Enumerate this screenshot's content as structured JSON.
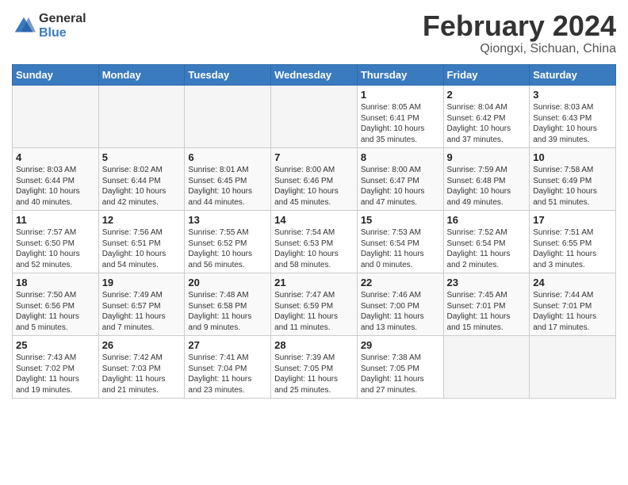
{
  "header": {
    "logo_general": "General",
    "logo_blue": "Blue",
    "title": "February 2024",
    "location": "Qiongxi, Sichuan, China"
  },
  "weekdays": [
    "Sunday",
    "Monday",
    "Tuesday",
    "Wednesday",
    "Thursday",
    "Friday",
    "Saturday"
  ],
  "weeks": [
    [
      {
        "day": "",
        "info": ""
      },
      {
        "day": "",
        "info": ""
      },
      {
        "day": "",
        "info": ""
      },
      {
        "day": "",
        "info": ""
      },
      {
        "day": "1",
        "info": "Sunrise: 8:05 AM\nSunset: 6:41 PM\nDaylight: 10 hours\nand 35 minutes."
      },
      {
        "day": "2",
        "info": "Sunrise: 8:04 AM\nSunset: 6:42 PM\nDaylight: 10 hours\nand 37 minutes."
      },
      {
        "day": "3",
        "info": "Sunrise: 8:03 AM\nSunset: 6:43 PM\nDaylight: 10 hours\nand 39 minutes."
      }
    ],
    [
      {
        "day": "4",
        "info": "Sunrise: 8:03 AM\nSunset: 6:44 PM\nDaylight: 10 hours\nand 40 minutes."
      },
      {
        "day": "5",
        "info": "Sunrise: 8:02 AM\nSunset: 6:44 PM\nDaylight: 10 hours\nand 42 minutes."
      },
      {
        "day": "6",
        "info": "Sunrise: 8:01 AM\nSunset: 6:45 PM\nDaylight: 10 hours\nand 44 minutes."
      },
      {
        "day": "7",
        "info": "Sunrise: 8:00 AM\nSunset: 6:46 PM\nDaylight: 10 hours\nand 45 minutes."
      },
      {
        "day": "8",
        "info": "Sunrise: 8:00 AM\nSunset: 6:47 PM\nDaylight: 10 hours\nand 47 minutes."
      },
      {
        "day": "9",
        "info": "Sunrise: 7:59 AM\nSunset: 6:48 PM\nDaylight: 10 hours\nand 49 minutes."
      },
      {
        "day": "10",
        "info": "Sunrise: 7:58 AM\nSunset: 6:49 PM\nDaylight: 10 hours\nand 51 minutes."
      }
    ],
    [
      {
        "day": "11",
        "info": "Sunrise: 7:57 AM\nSunset: 6:50 PM\nDaylight: 10 hours\nand 52 minutes."
      },
      {
        "day": "12",
        "info": "Sunrise: 7:56 AM\nSunset: 6:51 PM\nDaylight: 10 hours\nand 54 minutes."
      },
      {
        "day": "13",
        "info": "Sunrise: 7:55 AM\nSunset: 6:52 PM\nDaylight: 10 hours\nand 56 minutes."
      },
      {
        "day": "14",
        "info": "Sunrise: 7:54 AM\nSunset: 6:53 PM\nDaylight: 10 hours\nand 58 minutes."
      },
      {
        "day": "15",
        "info": "Sunrise: 7:53 AM\nSunset: 6:54 PM\nDaylight: 11 hours\nand 0 minutes."
      },
      {
        "day": "16",
        "info": "Sunrise: 7:52 AM\nSunset: 6:54 PM\nDaylight: 11 hours\nand 2 minutes."
      },
      {
        "day": "17",
        "info": "Sunrise: 7:51 AM\nSunset: 6:55 PM\nDaylight: 11 hours\nand 3 minutes."
      }
    ],
    [
      {
        "day": "18",
        "info": "Sunrise: 7:50 AM\nSunset: 6:56 PM\nDaylight: 11 hours\nand 5 minutes."
      },
      {
        "day": "19",
        "info": "Sunrise: 7:49 AM\nSunset: 6:57 PM\nDaylight: 11 hours\nand 7 minutes."
      },
      {
        "day": "20",
        "info": "Sunrise: 7:48 AM\nSunset: 6:58 PM\nDaylight: 11 hours\nand 9 minutes."
      },
      {
        "day": "21",
        "info": "Sunrise: 7:47 AM\nSunset: 6:59 PM\nDaylight: 11 hours\nand 11 minutes."
      },
      {
        "day": "22",
        "info": "Sunrise: 7:46 AM\nSunset: 7:00 PM\nDaylight: 11 hours\nand 13 minutes."
      },
      {
        "day": "23",
        "info": "Sunrise: 7:45 AM\nSunset: 7:01 PM\nDaylight: 11 hours\nand 15 minutes."
      },
      {
        "day": "24",
        "info": "Sunrise: 7:44 AM\nSunset: 7:01 PM\nDaylight: 11 hours\nand 17 minutes."
      }
    ],
    [
      {
        "day": "25",
        "info": "Sunrise: 7:43 AM\nSunset: 7:02 PM\nDaylight: 11 hours\nand 19 minutes."
      },
      {
        "day": "26",
        "info": "Sunrise: 7:42 AM\nSunset: 7:03 PM\nDaylight: 11 hours\nand 21 minutes."
      },
      {
        "day": "27",
        "info": "Sunrise: 7:41 AM\nSunset: 7:04 PM\nDaylight: 11 hours\nand 23 minutes."
      },
      {
        "day": "28",
        "info": "Sunrise: 7:39 AM\nSunset: 7:05 PM\nDaylight: 11 hours\nand 25 minutes."
      },
      {
        "day": "29",
        "info": "Sunrise: 7:38 AM\nSunset: 7:05 PM\nDaylight: 11 hours\nand 27 minutes."
      },
      {
        "day": "",
        "info": ""
      },
      {
        "day": "",
        "info": ""
      }
    ]
  ]
}
